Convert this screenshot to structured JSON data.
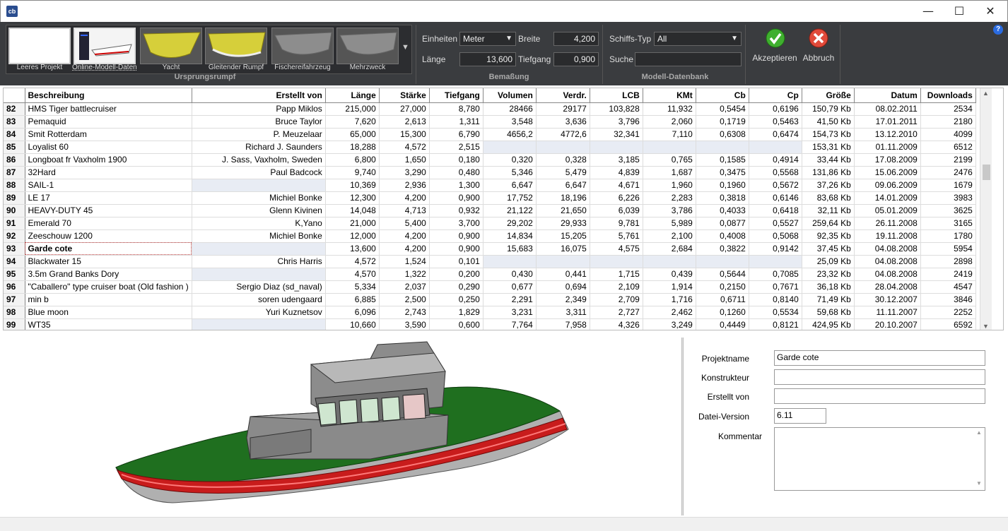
{
  "window": {
    "logo": "cb",
    "minimize": "—",
    "maximize": "☐",
    "close": "✕"
  },
  "ribbon": {
    "thumbnails": [
      {
        "label": "Leeres Projekt"
      },
      {
        "label": "Online-Modell-Daten..."
      },
      {
        "label": "Yacht"
      },
      {
        "label": "Gleitender Rumpf"
      },
      {
        "label": "Fischereifahrzeug"
      },
      {
        "label": "Mehrzweck"
      }
    ],
    "group_ursprung": "Ursprungsrumpf",
    "einheiten_label": "Einheiten",
    "einheiten_value": "Meter",
    "breite_label": "Breite",
    "breite_value": "4,200",
    "laenge_label": "Länge",
    "laenge_value": "13,600",
    "tiefgang_label": "Tiefgang",
    "tiefgang_value": "0,900",
    "group_bemassung": "Bemaßung",
    "schiffstyp_label": "Schiffs-Typ",
    "schiffstyp_value": "All",
    "suche_label": "Suche",
    "suche_value": "",
    "group_datenbank": "Modell-Datenbank",
    "accept_label": "Akzeptieren",
    "cancel_label": "Abbruch",
    "help": "?"
  },
  "grid": {
    "headers": [
      "",
      "Beschreibung",
      "Erstellt von",
      "Länge",
      "Stärke",
      "Tiefgang",
      "Volumen",
      "Verdr.",
      "LCB",
      "KMt",
      "Cb",
      "Cp",
      "Größe",
      "Datum",
      "Downloads"
    ],
    "rows": [
      [
        "82",
        "HMS Tiger battlecruiser",
        "Papp Miklos",
        "215,000",
        "27,000",
        "8,780",
        "28466",
        "29177",
        "103,828",
        "11,932",
        "0,5454",
        "0,6196",
        "150,79 Kb",
        "08.02.2011",
        "2534"
      ],
      [
        "83",
        "Pemaquid",
        "Bruce Taylor",
        "7,620",
        "2,613",
        "1,311",
        "3,548",
        "3,636",
        "3,796",
        "2,060",
        "0,1719",
        "0,5463",
        "41,50 Kb",
        "17.01.2011",
        "2180"
      ],
      [
        "84",
        "Smit Rotterdam",
        "P. Meuzelaar",
        "65,000",
        "15,300",
        "6,790",
        "4656,2",
        "4772,6",
        "32,341",
        "7,110",
        "0,6308",
        "0,6474",
        "154,73 Kb",
        "13.12.2010",
        "4099"
      ],
      [
        "85",
        "Loyalist 60",
        "Richard J. Saunders",
        "18,288",
        "4,572",
        "2,515",
        "",
        "",
        "",
        "",
        "",
        "",
        "153,31 Kb",
        "01.11.2009",
        "6512"
      ],
      [
        "86",
        "Longboat fr Vaxholm 1900",
        "J. Sass, Vaxholm, Sweden",
        "6,800",
        "1,650",
        "0,180",
        "0,320",
        "0,328",
        "3,185",
        "0,765",
        "0,1585",
        "0,4914",
        "33,44 Kb",
        "17.08.2009",
        "2199"
      ],
      [
        "87",
        "32Hard",
        "Paul Badcock",
        "9,740",
        "3,290",
        "0,480",
        "5,346",
        "5,479",
        "4,839",
        "1,687",
        "0,3475",
        "0,5568",
        "131,86 Kb",
        "15.06.2009",
        "2476"
      ],
      [
        "88",
        "SAIL-1",
        "",
        "10,369",
        "2,936",
        "1,300",
        "6,647",
        "6,647",
        "4,671",
        "1,960",
        "0,1960",
        "0,5672",
        "37,26 Kb",
        "09.06.2009",
        "1679"
      ],
      [
        "89",
        "LE 17",
        "Michiel Bonke",
        "12,300",
        "4,200",
        "0,900",
        "17,752",
        "18,196",
        "6,226",
        "2,283",
        "0,3818",
        "0,6146",
        "83,68 Kb",
        "14.01.2009",
        "3983"
      ],
      [
        "90",
        "HEAVY-DUTY 45",
        "Glenn Kivinen",
        "14,048",
        "4,713",
        "0,932",
        "21,122",
        "21,650",
        "6,039",
        "3,786",
        "0,4033",
        "0,6418",
        "32,11 Kb",
        "05.01.2009",
        "3625"
      ],
      [
        "91",
        "Emerald 70",
        "K,Yano",
        "21,000",
        "5,400",
        "3,700",
        "29,202",
        "29,933",
        "9,781",
        "5,989",
        "0,0877",
        "0,5527",
        "259,64 Kb",
        "26.11.2008",
        "3165"
      ],
      [
        "92",
        "Zeeschouw 1200",
        "Michiel Bonke",
        "12,000",
        "4,200",
        "0,900",
        "14,834",
        "15,205",
        "5,761",
        "2,100",
        "0,4008",
        "0,5068",
        "92,35 Kb",
        "19.11.2008",
        "1780"
      ],
      [
        "93",
        "Garde cote",
        "",
        "13,600",
        "4,200",
        "0,900",
        "15,683",
        "16,075",
        "4,575",
        "2,684",
        "0,3822",
        "0,9142",
        "37,45 Kb",
        "04.08.2008",
        "5954"
      ],
      [
        "94",
        "Blackwater 15",
        "Chris Harris",
        "4,572",
        "1,524",
        "0,101",
        "",
        "",
        "",
        "",
        "",
        "",
        "25,09 Kb",
        "04.08.2008",
        "2898"
      ],
      [
        "95",
        "3.5m Grand Banks Dory",
        "",
        "4,570",
        "1,322",
        "0,200",
        "0,430",
        "0,441",
        "1,715",
        "0,439",
        "0,5644",
        "0,7085",
        "23,32 Kb",
        "04.08.2008",
        "2419"
      ],
      [
        "96",
        "\"Caballero\" type cruiser boat (Old fashion )",
        "Sergio Diaz (sd_naval)",
        "5,334",
        "2,037",
        "0,290",
        "0,677",
        "0,694",
        "2,109",
        "1,914",
        "0,2150",
        "0,7671",
        "36,18 Kb",
        "28.04.2008",
        "4547"
      ],
      [
        "97",
        "min b",
        "soren udengaard",
        "6,885",
        "2,500",
        "0,250",
        "2,291",
        "2,349",
        "2,709",
        "1,716",
        "0,6711",
        "0,8140",
        "71,49 Kb",
        "30.12.2007",
        "3846"
      ],
      [
        "98",
        "Blue moon",
        "Yuri Kuznetsov",
        "6,096",
        "2,743",
        "1,829",
        "3,231",
        "3,311",
        "2,727",
        "2,462",
        "0,1260",
        "0,5534",
        "59,68 Kb",
        "11.11.2007",
        "2252"
      ],
      [
        "99",
        "WT35",
        "",
        "10,660",
        "3,590",
        "0,600",
        "7,764",
        "7,958",
        "4,326",
        "3,249",
        "0,4449",
        "0,8121",
        "424,95 Kb",
        "20.10.2007",
        "6592"
      ]
    ],
    "selected_row": 11
  },
  "props": {
    "projektname_label": "Projektname",
    "projektname_value": "Garde cote",
    "konstrukteur_label": "Konstrukteur",
    "konstrukteur_value": "",
    "erstellt_label": "Erstellt von",
    "erstellt_value": "",
    "version_label": "Datei-Version",
    "version_value": "6.11",
    "kommentar_label": "Kommentar",
    "kommentar_value": ""
  },
  "colors": {
    "ribbon_bg": "#3a3c3f",
    "hull_deck": "#1a6a1a",
    "hull_fender": "#c41a1a",
    "superstructure": "#8c8c8c"
  }
}
